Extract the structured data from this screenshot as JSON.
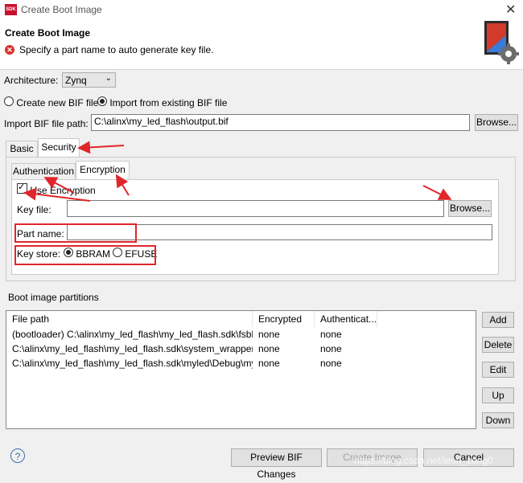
{
  "window": {
    "app_badge": "SDK",
    "title": "Create Boot Image",
    "close_glyph": "✕"
  },
  "header": {
    "title": "Create Boot Image",
    "message": "Specify a part name to auto generate key file.",
    "icon": "error-icon"
  },
  "architecture": {
    "label": "Architecture:",
    "value": "Zynq"
  },
  "bif_mode": {
    "create_label": "Create new BIF file",
    "import_label": "Import from existing BIF file",
    "selected": "import"
  },
  "import_path": {
    "label": "Import BIF file path:",
    "value": "C:\\alinx\\my_led_flash\\output.bif",
    "browse_label": "Browse..."
  },
  "tabs": [
    {
      "label": "Basic"
    },
    {
      "label": "Security",
      "selected": true
    }
  ],
  "subtabs": [
    {
      "label": "Authentication"
    },
    {
      "label": "Encryption",
      "selected": true
    }
  ],
  "encryption": {
    "use_label": "Use Encryption",
    "use_checked": true,
    "key_file_label": "Key file:",
    "key_file_value": "",
    "browse_label": "Browse...",
    "part_name_label": "Part name:",
    "part_name_value": "",
    "key_store_label": "Key store:",
    "bbram_label": "BBRAM",
    "efuse_label": "EFUSE",
    "key_store_selected": "BBRAM"
  },
  "partitions": {
    "label": "Boot image partitions",
    "columns": [
      "File path",
      "Encrypted",
      "Authenticat..."
    ],
    "rows": [
      [
        "(bootloader) C:\\alinx\\my_led_flash\\my_led_flash.sdk\\fsbl\\...",
        "none",
        "none"
      ],
      [
        "C:\\alinx\\my_led_flash\\my_led_flash.sdk\\system_wrapper_h...",
        "none",
        "none"
      ],
      [
        "C:\\alinx\\my_led_flash\\my_led_flash.sdk\\myled\\Debug\\myl...",
        "none",
        "none"
      ]
    ],
    "buttons": {
      "add": "Add",
      "delete": "Delete",
      "edit": "Edit",
      "up": "Up",
      "down": "Down"
    }
  },
  "footer": {
    "help": "?",
    "preview_label": "Preview BIF Changes",
    "create_label": "Create Image",
    "cancel_label": "Cancel",
    "watermark": "https://blog.csdn.net/leon_zeng0"
  },
  "colors": {
    "annotation_red": "#e0262a",
    "accent": "#0078d7"
  }
}
